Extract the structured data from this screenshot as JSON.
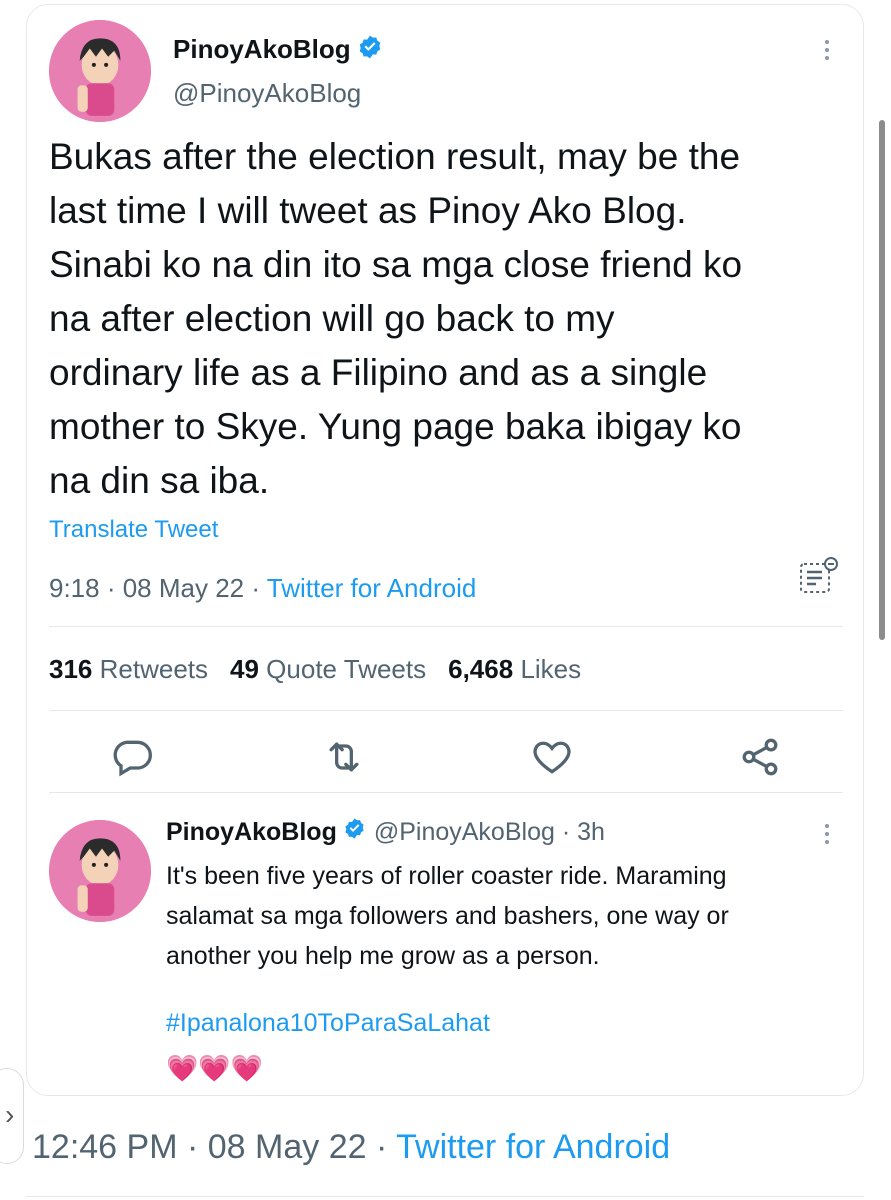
{
  "main_tweet": {
    "display_name": "PinoyAkoBlog",
    "handle": "@PinoyAkoBlog",
    "text": "Bukas after the election result, may be the\nlast time I will tweet as Pinoy Ako Blog.\nSinabi ko na din ito sa mga close friend ko\nna after election will go back to my\nordinary life as a Filipino  and as a single\nmother to Skye. Yung page baka ibigay ko\nna din sa iba.",
    "translate_label": "Translate Tweet",
    "time": "9:18",
    "date": "08 May 22",
    "app": "Twitter for Android",
    "separator": " · ",
    "stats": {
      "retweets_count": "316",
      "retweets_label": "Retweets",
      "quotes_count": "49",
      "quotes_label": "Quote Tweets",
      "likes_count": "6,468",
      "likes_label": "Likes"
    }
  },
  "quoted_tweet": {
    "display_name": "PinoyAkoBlog",
    "handle_time": "@PinoyAkoBlog · 3h",
    "text": "It's been five years of roller coaster ride. Maraming\nsalamat sa mga followers and bashers, one way or\nanother you help me grow as a person.",
    "hashtag": "#Ipanalona10ToParaSaLahat",
    "hearts": "💗💗💗"
  },
  "footer": {
    "time": "12:46 PM",
    "date": "08 May 22",
    "app": "Twitter for Android",
    "separator": " · "
  },
  "icons": {
    "reply": "reply-icon",
    "retweet": "retweet-icon",
    "like": "heart-icon",
    "share": "share-icon",
    "verified": "verified-badge-icon",
    "analytics": "analytics-icon",
    "more": "more-icon"
  },
  "colors": {
    "accent": "#1d9bf0",
    "muted": "#536471",
    "text": "#0f1419",
    "avatar_bg": "#e87fb3"
  }
}
